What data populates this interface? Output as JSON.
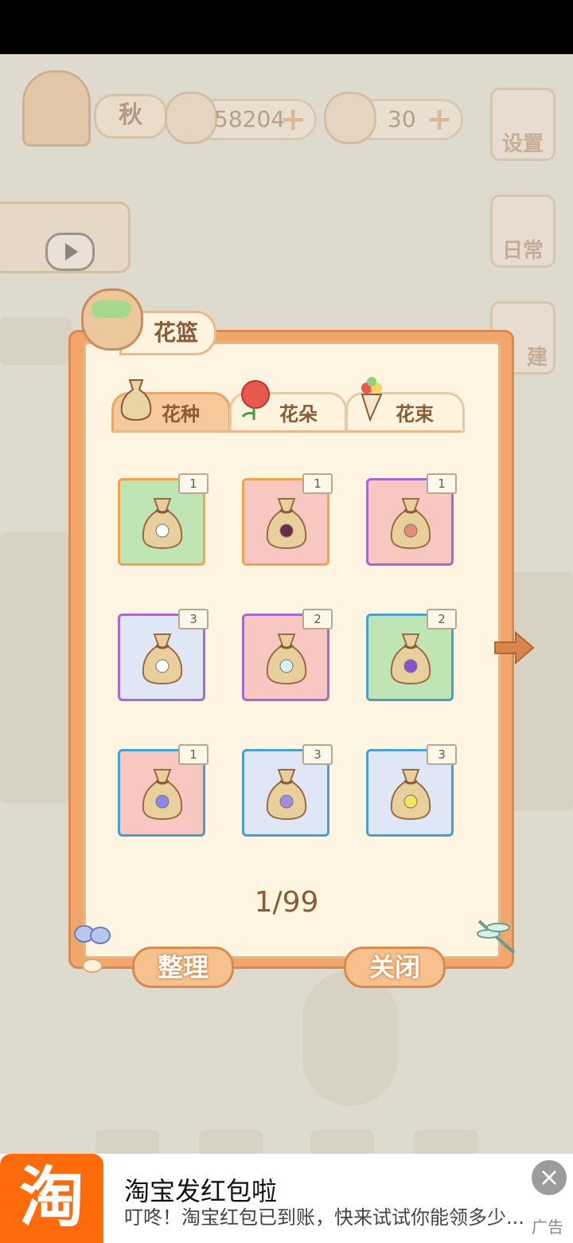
{
  "hud": {
    "season_label": "秋",
    "coins": "58204",
    "cheese": "30",
    "settings_label": "设置",
    "daily_label": "日常",
    "build_label": "建"
  },
  "panel": {
    "title": "花篮",
    "tabs": [
      {
        "label": "花种",
        "active": true
      },
      {
        "label": "花朵",
        "active": false
      },
      {
        "label": "花束",
        "active": false
      }
    ],
    "items": [
      {
        "count": "1",
        "bg": "#bfe5b4",
        "border": "#f0a24e",
        "flower": "#ffffff"
      },
      {
        "count": "1",
        "bg": "#f8c7c1",
        "border": "#f0a24e",
        "flower": "#6b2a4a"
      },
      {
        "count": "1",
        "bg": "#f8c7c1",
        "border": "#a56ad1",
        "flower": "#e98a7a"
      },
      {
        "count": "3",
        "bg": "#dfe7f7",
        "border": "#a56ad1",
        "flower": "#ffffff"
      },
      {
        "count": "2",
        "bg": "#f8c7c1",
        "border": "#a56ad1",
        "flower": "#d8f0f4"
      },
      {
        "count": "2",
        "bg": "#bfe5b4",
        "border": "#4aa0c9",
        "flower": "#8b4fd1"
      },
      {
        "count": "1",
        "bg": "#f8c7c1",
        "border": "#4aa0c9",
        "flower": "#8f86e8"
      },
      {
        "count": "3",
        "bg": "#dfe7f7",
        "border": "#4aa0c9",
        "flower": "#a08de0"
      },
      {
        "count": "3",
        "bg": "#dfe7f7",
        "border": "#4aa0c9",
        "flower": "#f7e45a"
      }
    ],
    "page": "1/99",
    "sort_label": "整理",
    "close_label": "关闭"
  },
  "ad": {
    "logo_char": "淘",
    "title": "淘宝发红包啦",
    "subtitle": "叮咚！淘宝红包已到账，快来试试你能领多少...",
    "tag": "广告",
    "close_icon": "×"
  },
  "colors": {
    "panel_frame": "#f1a76c",
    "panel_bg": "#fdf5e1",
    "text_brown": "#8b5b36",
    "ad_brand": "#ff6a0b"
  }
}
